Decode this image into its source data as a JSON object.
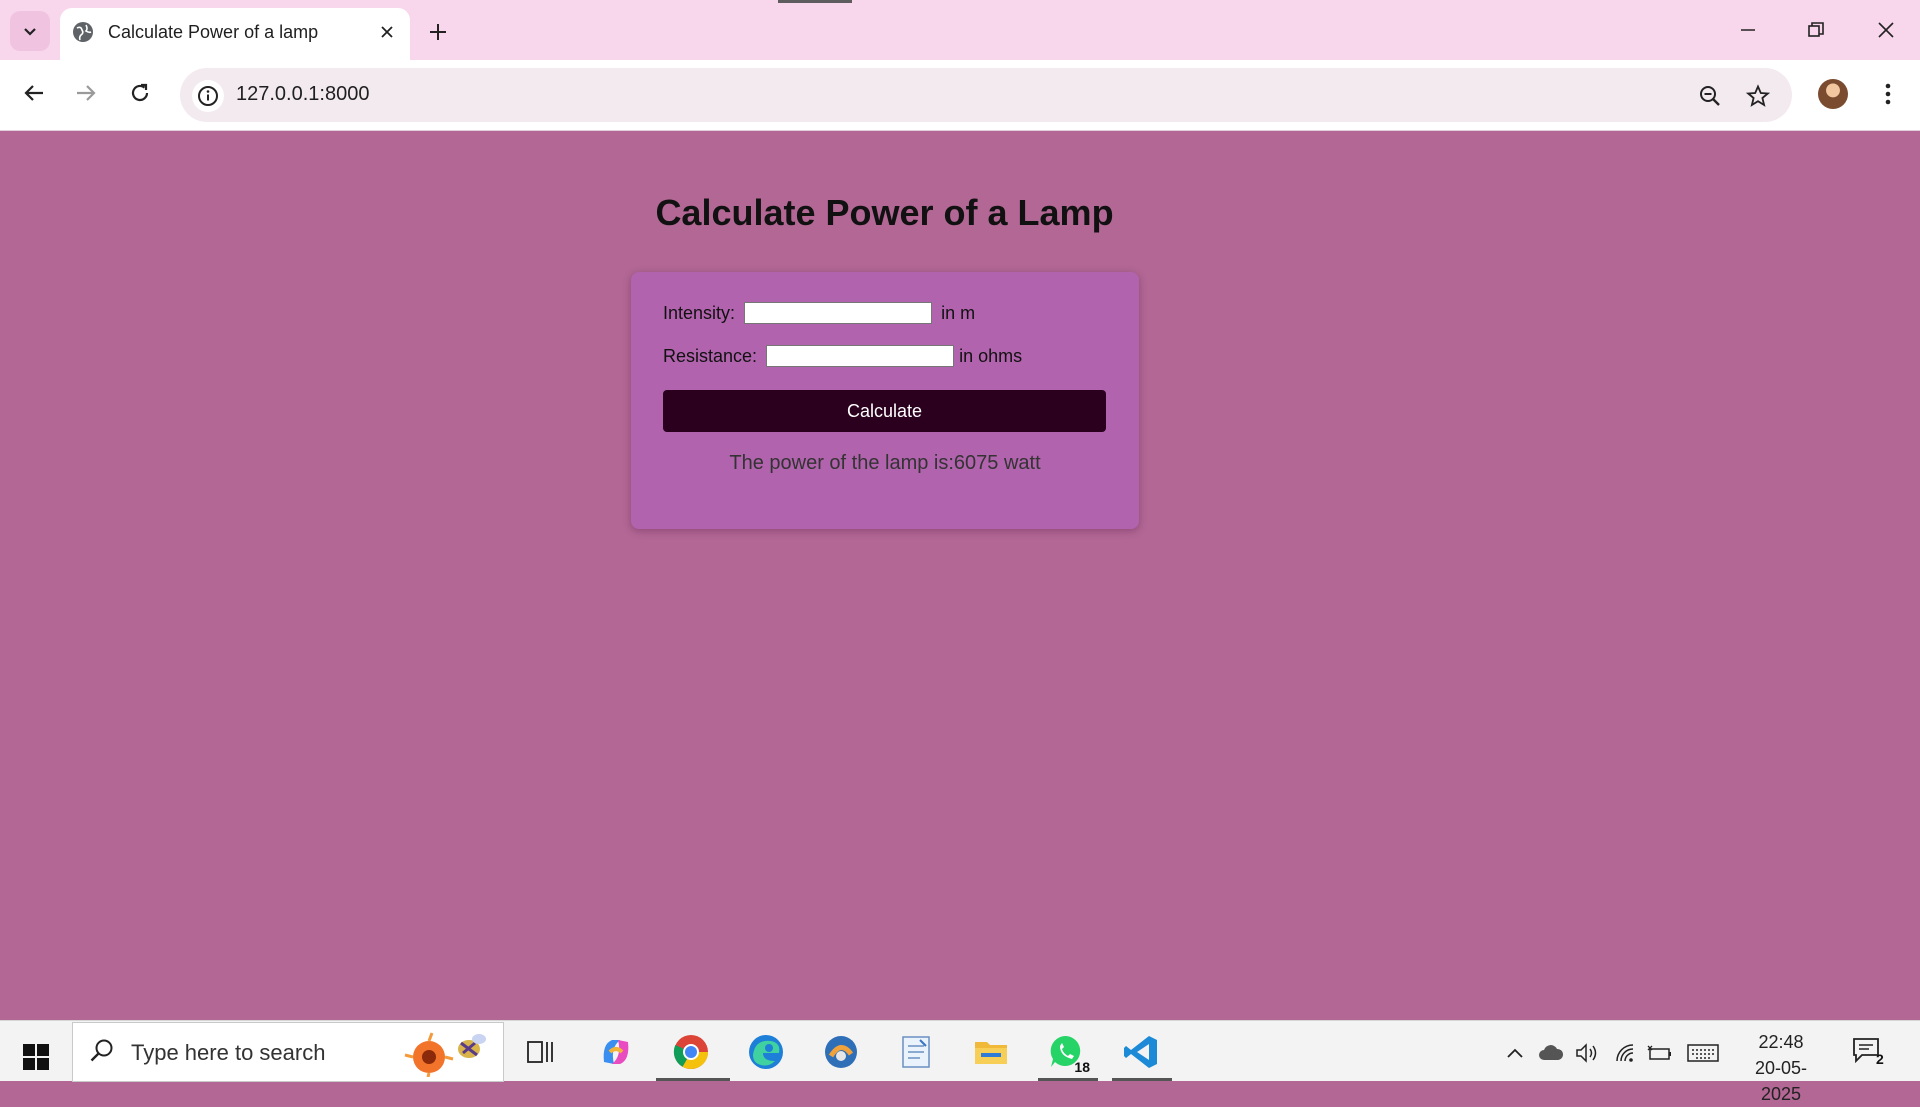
{
  "browser": {
    "tab_title": "Calculate Power of a lamp",
    "url": "127.0.0.1:8000"
  },
  "page": {
    "title": "Calculate Power of a Lamp",
    "form": {
      "intensity_label": "Intensity:",
      "intensity_value": "",
      "intensity_unit": "in m",
      "resistance_label": "Resistance:",
      "resistance_value": "",
      "resistance_unit": "in ohms",
      "calculate_label": "Calculate"
    },
    "result": "The power of the lamp is:6075 watt"
  },
  "taskbar": {
    "search_placeholder": "Type here to search",
    "apps": [
      "task-view-icon",
      "copilot-icon",
      "chrome-icon",
      "edge-icon",
      "app-icon",
      "notepad-icon",
      "file-explorer-icon",
      "whatsapp-icon",
      "vscode-icon"
    ],
    "whatsapp_badge": "18",
    "time": "22:48",
    "date": "20-05-2025",
    "notification_count": "2"
  },
  "colors": {
    "page_background": "#b26794",
    "card_background": "#b263ae",
    "button_background": "#2a001e",
    "tabbar_background": "#f8d6ec"
  }
}
